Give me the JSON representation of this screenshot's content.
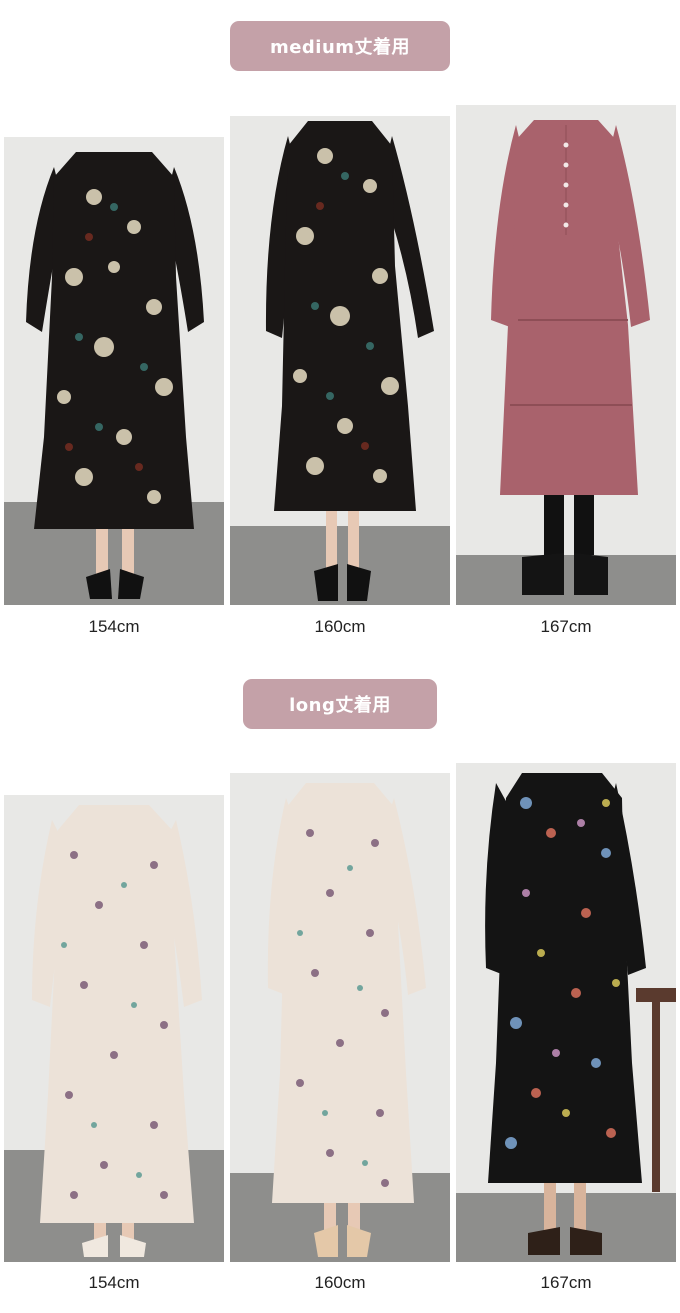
{
  "sections": [
    {
      "badge": "medium丈着用",
      "photos": [
        {
          "height_label": "154cm",
          "dress": "black floral print tiered dress",
          "color": "#1a1716"
        },
        {
          "height_label": "160cm",
          "dress": "black floral print tiered dress",
          "color": "#1a1716"
        },
        {
          "height_label": "167cm",
          "dress": "mauve pink tiered dress",
          "color": "#a9626c"
        }
      ]
    },
    {
      "badge": "long丈着用",
      "photos": [
        {
          "height_label": "154cm",
          "dress": "ivory floral print tiered dress",
          "color": "#ece2d8"
        },
        {
          "height_label": "160cm",
          "dress": "ivory floral print tiered dress",
          "color": "#ece2d8"
        },
        {
          "height_label": "167cm",
          "dress": "black botanical print tiered dress",
          "color": "#141414"
        }
      ]
    }
  ],
  "colors": {
    "badge_bg": "#c4a1a8",
    "badge_text": "#ffffff",
    "wall": "#e7e7e5",
    "floor": "#8c8c8a"
  }
}
